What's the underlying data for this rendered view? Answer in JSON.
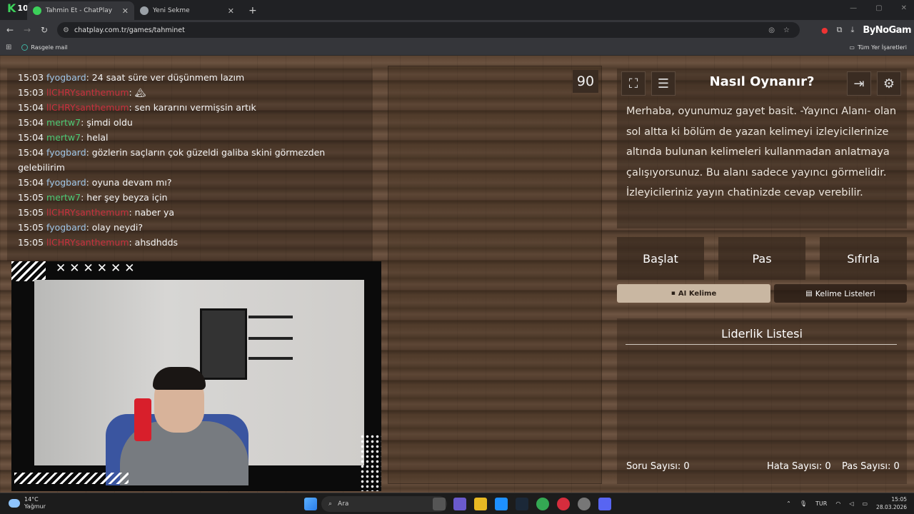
{
  "browser": {
    "tabs": [
      {
        "title": "Tahmin Et - ChatPlay",
        "active": true
      },
      {
        "title": "Yeni Sekme",
        "active": false
      }
    ],
    "extension_badge": "10",
    "url": "chatplay.com.tr/games/tahminet",
    "toolbar_logo": "ByNoGam",
    "bookmarks": {
      "left": "Rasgele mail",
      "right": "Tüm Yer İşaretleri"
    }
  },
  "chat": {
    "messages": [
      {
        "time": "15:03",
        "user": "fyogbard",
        "color": "blue",
        "text": ": 24 saat süre ver düşünmem lazım"
      },
      {
        "time": "15:03",
        "user": "llCHRYsanthemum",
        "color": "red",
        "text": ": 🏔"
      },
      {
        "time": "15:04",
        "user": "llCHRYsanthemum",
        "color": "red",
        "text": ": sen kararını vermişsin artık"
      },
      {
        "time": "15:04",
        "user": "mertw7",
        "color": "green",
        "text": ": şimdi oldu"
      },
      {
        "time": "15:04",
        "user": "mertw7",
        "color": "green",
        "text": ": helal"
      },
      {
        "time": "15:04",
        "user": "fyogbard",
        "color": "blue",
        "text": ": gözlerin saçların çok güzeldi galiba skini görmezden gelebilirim"
      },
      {
        "time": "15:04",
        "user": "fyogbard",
        "color": "blue",
        "text": ": oyuna devam mı?"
      },
      {
        "time": "15:05",
        "user": "mertw7",
        "color": "green",
        "text": ": her şey beyza için"
      },
      {
        "time": "15:05",
        "user": "llCHRYsanthemum",
        "color": "red",
        "text": ": naber ya"
      },
      {
        "time": "15:05",
        "user": "fyogbard",
        "color": "blue",
        "text": ": olay neydi?"
      },
      {
        "time": "15:05",
        "user": "llCHRYsanthemum",
        "color": "red",
        "text": ": ahsdhdds"
      }
    ]
  },
  "webcam": {
    "overlay_marks": "✕✕✕✕✕✕"
  },
  "game": {
    "timer": "90",
    "how_to_title": "Nasıl Oynanır?",
    "how_to_text": "Merhaba, oyunumuz gayet basit. -Yayıncı Alanı- olan sol altta ki bölüm de yazan kelimeyi izleyicilerinize altında bulunan kelimeleri kullanmadan anlatmaya çalışıyorsunuz. Bu alanı sadece yayıncı görmelidir. İzleyicileriniz yayın chatinizde cevap verebilir.",
    "buttons": {
      "start": "Başlat",
      "pass": "Pas",
      "reset": "Sıfırla"
    },
    "ai_word": "AI Kelime",
    "word_lists": "Kelime Listeleri",
    "leaderboard_title": "Liderlik Listesi",
    "stats": {
      "questions": "Soru Sayısı: 0",
      "errors": "Hata Sayısı: 0",
      "passes": "Pas Sayısı: 0"
    }
  },
  "taskbar": {
    "temperature": "14°C",
    "weather": "Yağmur",
    "search": "Ara",
    "language": "TUR",
    "time": "15:05",
    "date": "28.03.2026"
  },
  "colors": {
    "user_blue": "#9fc6e8",
    "user_green": "#4cc974",
    "user_red": "#c8303e",
    "ai_button_bg": "#c9b7a2"
  }
}
